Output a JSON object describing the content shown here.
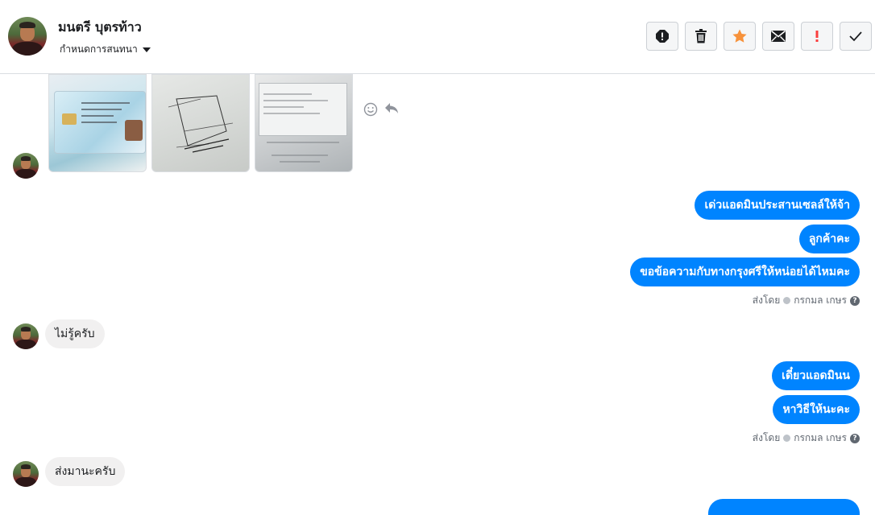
{
  "header": {
    "name": "มนตรี บุตรท้าว",
    "subtitle": "กำหนดการสนทนา",
    "toolbar": {
      "icons": [
        "alert-icon",
        "trash-icon",
        "star-icon",
        "mail-icon",
        "exclamation-icon",
        "check-icon"
      ],
      "colors": {
        "star": "#f7923b",
        "exclamation": "#fa3e3e",
        "default": "#4b4f56"
      }
    }
  },
  "thread": {
    "outgoing_1": [
      "เด่วแอดมินประสานเซลล์ให้จ้า",
      "ลูกค้าคะ",
      "ขอข้อความกับทางกรุงศรีให้หน่อยได้ไหมคะ"
    ],
    "sent_by_1": {
      "prefix": "ส่งโดย",
      "agent": "กรกมล เกษร",
      "help": "?"
    },
    "incoming_1": "ไม่รู้ครับ",
    "outgoing_2": [
      "เดี๋ยวแอดมินน",
      "หาวิธีให้นะคะ"
    ],
    "sent_by_2": {
      "prefix": "ส่งโดย",
      "agent": "กรกมล เกษร",
      "help": "?"
    },
    "incoming_2": "ส่งมานะครับ"
  },
  "colors": {
    "outgoing_bubble": "#0084ff",
    "incoming_bubble": "#f1f0f0"
  }
}
